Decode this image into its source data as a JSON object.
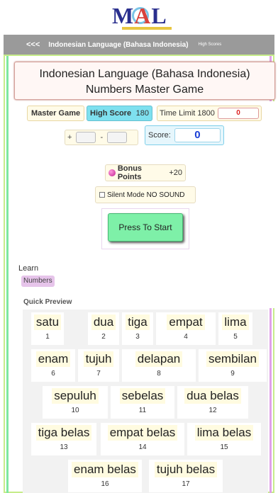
{
  "logo": {
    "m": "M",
    "a": "A",
    "l": "L"
  },
  "nav": {
    "back": "<<<",
    "title": "Indonesian Language (Bahasa Indonesia)",
    "high_scores": "High Scores"
  },
  "title": {
    "line1": "Indonesian Language (Bahasa Indonesia)",
    "line2": "Numbers Master Game"
  },
  "game": {
    "master_label": "Master Game",
    "high_score_label": "High Score",
    "high_score_value": "180",
    "time_limit_label": "Time Limit 1800",
    "time_value": "0",
    "plus": "+",
    "minus": "-",
    "score_label": "Score:",
    "score_value": "0",
    "bonus_label": "Bonus Points",
    "bonus_value": "+20",
    "silent_label": "Silent Mode NO SOUND",
    "start_label": "Press To Start"
  },
  "learn": {
    "label": "Learn",
    "numbers": "Numbers"
  },
  "preview": {
    "label": "Quick Preview",
    "items": [
      {
        "word": "satu",
        "num": "1"
      },
      {
        "word": "dua",
        "num": "2"
      },
      {
        "word": "tiga",
        "num": "3"
      },
      {
        "word": "empat",
        "num": "4"
      },
      {
        "word": "lima",
        "num": "5"
      },
      {
        "word": "enam",
        "num": "6"
      },
      {
        "word": "tujuh",
        "num": "7"
      },
      {
        "word": "delapan",
        "num": "8"
      },
      {
        "word": "sembilan",
        "num": "9"
      },
      {
        "word": "sepuluh",
        "num": "10"
      },
      {
        "word": "sebelas",
        "num": "11"
      },
      {
        "word": "dua belas",
        "num": "12"
      },
      {
        "word": "tiga belas",
        "num": "13"
      },
      {
        "word": "empat belas",
        "num": "14"
      },
      {
        "word": "lima belas",
        "num": "15"
      },
      {
        "word": "enam belas",
        "num": "16"
      },
      {
        "word": "tujuh belas",
        "num": "17"
      }
    ]
  }
}
